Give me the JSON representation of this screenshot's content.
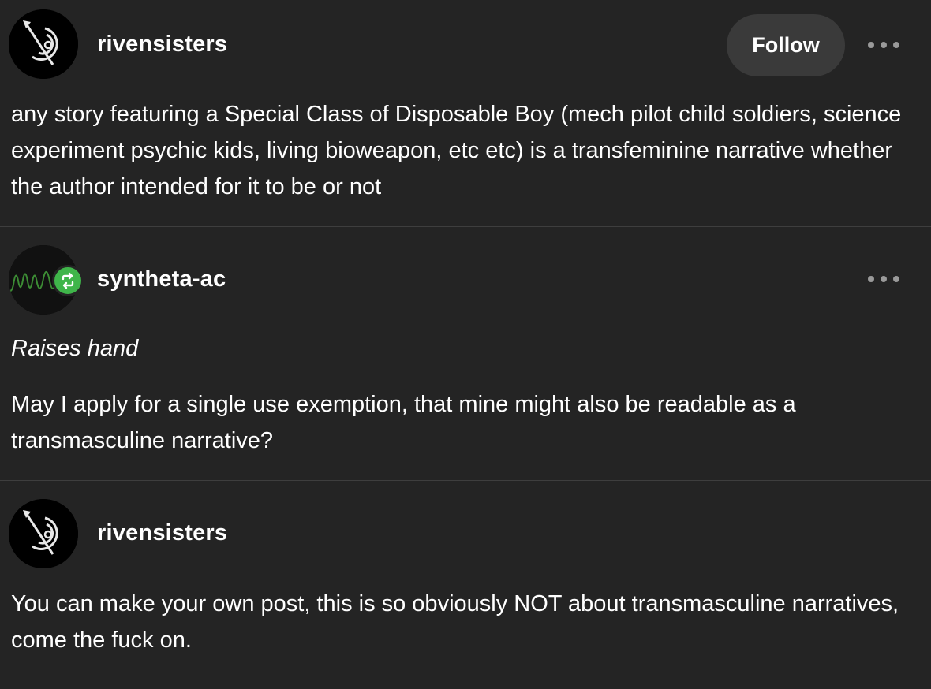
{
  "posts": [
    {
      "username": "rivensisters",
      "avatar_icon": "compass-dial-icon",
      "follow_label": "Follow",
      "more_icon": "more-options-icon",
      "paragraphs": [
        "any story featuring a Special Class of Disposable Boy (mech pilot child soldiers, science experiment psychic kids, living bioweapon, etc etc) is a transfeminine narrative whether the author intended for it to be or not"
      ]
    },
    {
      "username": "syntheta-ac",
      "avatar_icon": "waveform-icon",
      "badge_icon": "reblog-icon",
      "badge_color": "#3fb54a",
      "more_icon": "more-options-icon",
      "paragraphs": [
        "Raises hand",
        "May I apply for a single use exemption, that mine might also be readable as a transmasculine narrative?"
      ]
    },
    {
      "username": "rivensisters",
      "avatar_icon": "compass-dial-icon",
      "paragraphs": [
        "You can make your own post, this is so obviously NOT about transmasculine narratives, come the fuck on."
      ]
    }
  ],
  "colors": {
    "background": "#242424",
    "divider": "#3e3e3e",
    "follow_button_bg": "#3a3a3a",
    "waveform": "#3c8c34"
  }
}
